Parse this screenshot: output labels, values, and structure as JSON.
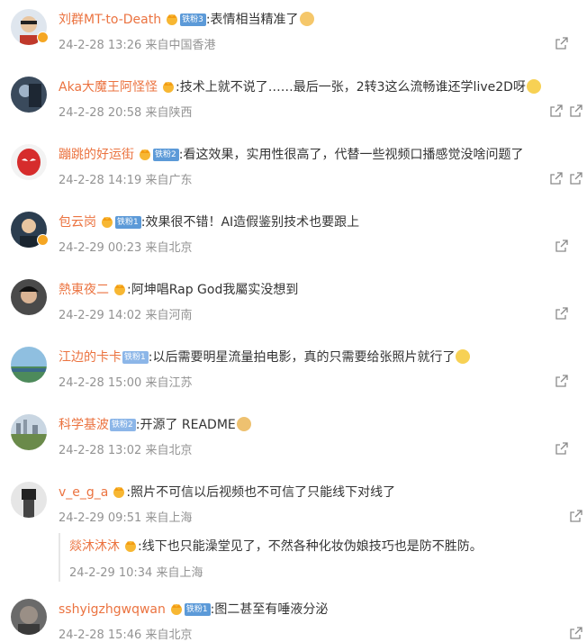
{
  "comments": [
    {
      "user": "刘群MT-to-Death",
      "fan": "铁粉3",
      "text": ":表情相当精准了",
      "emoji": "thumbs-up-emoji",
      "time": "24-2-28 13:26",
      "location": "来自中国香港"
    },
    {
      "user": "Aka大魔王阿怪怪",
      "fan": "",
      "text": ":技术上就不说了……最后一张，2转3这么流畅谁还学live2D呀",
      "emoji": "smile-emoji",
      "time": "24-2-28 20:58",
      "location": "来自陕西"
    },
    {
      "user": "蹦跳的好运街",
      "fan": "铁粉2",
      "text": ":看这效果，实用性很高了，代替一些视频口播感觉没啥问题了",
      "emoji": "",
      "time": "24-2-28 14:19",
      "location": "来自广东"
    },
    {
      "user": "包云岗",
      "fan": "铁粉1",
      "text": ":效果很不错！AI造假鉴别技术也要跟上",
      "emoji": "",
      "time": "24-2-29 00:23",
      "location": "来自北京"
    },
    {
      "user": "熱東夜二",
      "fan": "",
      "text": ":阿坤唱Rap God我屬实没想到",
      "emoji": "",
      "time": "24-2-29 14:02",
      "location": "来自河南"
    },
    {
      "user": "江边的卡卡",
      "fan": "铁粉1",
      "text": ":以后需要明星流量拍电影，真的只需要给张照片就行了",
      "emoji": "laugh-emoji",
      "time": "24-2-28 15:00",
      "location": "来自江苏"
    },
    {
      "user": "科学基波",
      "fan": "铁粉2",
      "text": ":开源了 README",
      "emoji": "doge-emoji",
      "time": "24-2-28 13:02",
      "location": "来自北京"
    },
    {
      "user": "v_e_g_a",
      "fan": "",
      "text": ":照片不可信以后视频也不可信了只能线下对线了",
      "emoji": "",
      "time": "24-2-29 09:51",
      "location": "来自上海"
    },
    {
      "user": "sshyigzhgwqwan",
      "fan": "铁粉1",
      "text": ":图二甚至有唾液分泌",
      "emoji": "",
      "time": "24-2-28 15:46",
      "location": "来自北京"
    }
  ],
  "reply": {
    "user": "燚沐沐沐",
    "text": ":线下也只能澡堂见了，不然各种化妆伪娘技巧也是防不胜防。",
    "time": "24-2-29 10:34",
    "location": "来自上海"
  },
  "colors": {
    "username": "#eb7340",
    "meta": "#939393",
    "text": "#333333",
    "fan_badge": "#5c9ad8"
  }
}
